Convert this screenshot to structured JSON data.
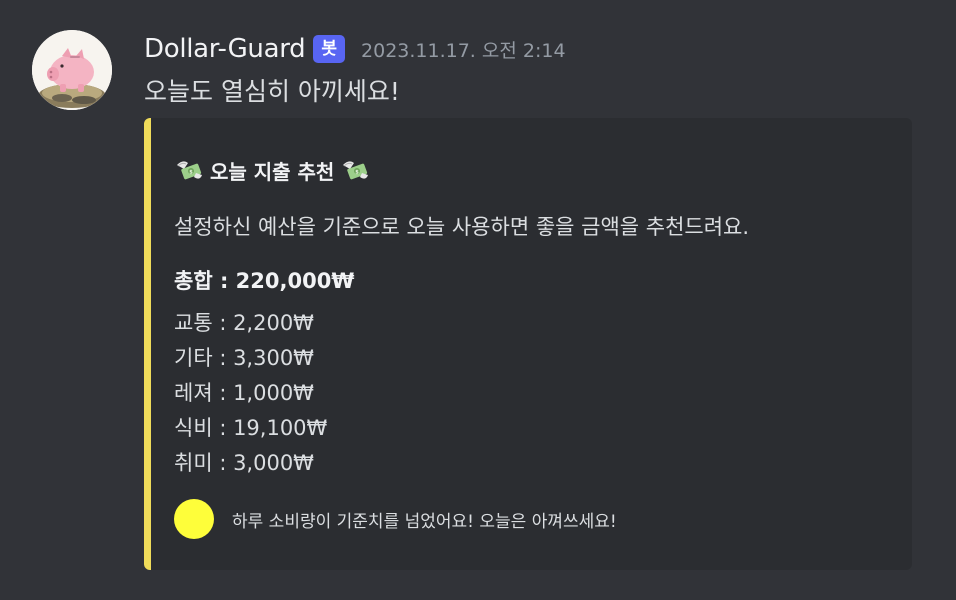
{
  "message": {
    "username": "Dollar-Guard",
    "bot_tag": "봇",
    "timestamp": "2023.11.17. 오전 2:14",
    "content": "오늘도 열심히 아끼세요!",
    "avatar_icon": "piggy-bank-on-coins"
  },
  "embed": {
    "accent_color": "#f0dc5a",
    "title_icon": "money-with-wings",
    "title": "오늘 지출 추천",
    "description": "설정하신 예산을 기준으로 오늘 사용하면 좋을 금액을 추천드려요.",
    "total": "총합 : 220,000₩",
    "items": [
      "교통 : 2,200₩",
      "기타 : 3,300₩",
      "레져 : 1,000₩",
      "식비 : 19,100₩",
      "취미 : 3,000₩"
    ],
    "footer_icon_color": "#fefe3a",
    "footer_text": "하루 소비량이 기준치를 넘었어요! 오늘은 아껴쓰세요!"
  }
}
